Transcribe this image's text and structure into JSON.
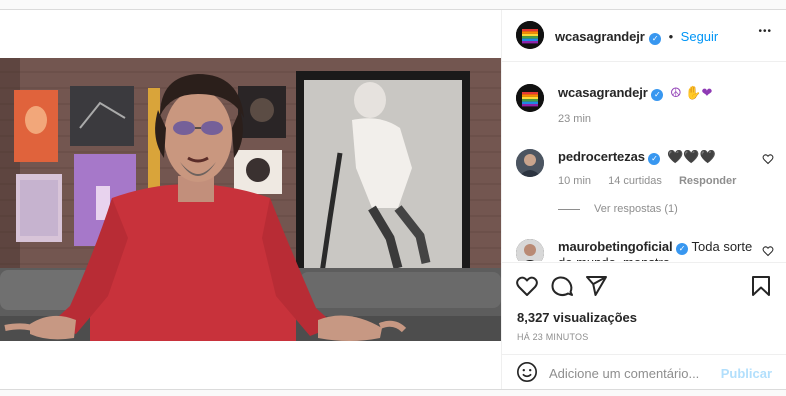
{
  "post": {
    "author": "wcasagrandejr",
    "separator": "•",
    "follow_label": "Seguir",
    "more_options": "•••"
  },
  "caption": {
    "author": "wcasagrandejr",
    "emojis": "☮ ✋❤",
    "time": "23 min"
  },
  "comments": [
    {
      "author": "pedrocertezas",
      "text": "🖤🖤🖤",
      "time": "10 min",
      "likes": "14 curtidas",
      "reply_label": "Responder",
      "view_replies": "Ver respostas (1)"
    },
    {
      "author": "maurobetingoficial",
      "text": "Toda sorte do mundo, monstro"
    }
  ],
  "stats": {
    "views": "8,327 visualizações",
    "time_ago": "HÁ 23 MINUTOS"
  },
  "comment_box": {
    "placeholder": "Adicione um comentário...",
    "publish_label": "Publicar"
  },
  "colors": {
    "accent": "#0095f6",
    "verified": "#3897f0",
    "publish_disabled": "#b2dffc"
  }
}
